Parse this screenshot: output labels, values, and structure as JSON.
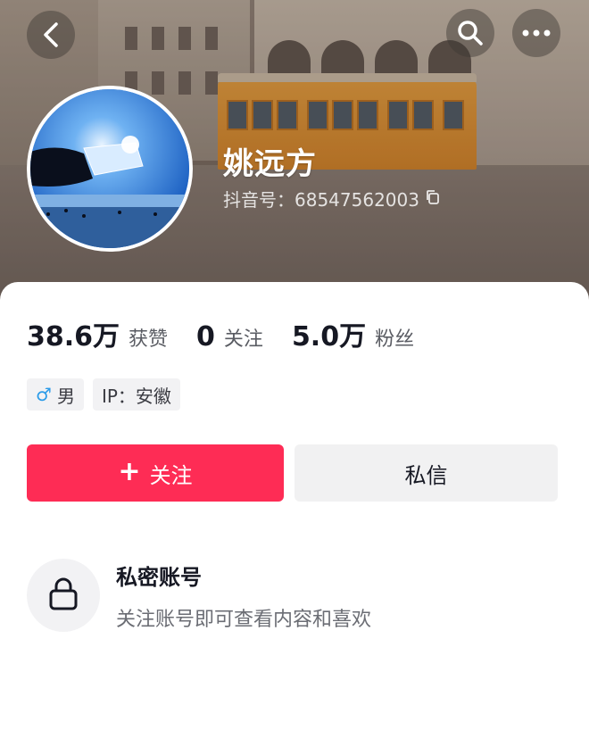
{
  "profile": {
    "name": "姚远方",
    "douyin_id": "抖音号：68547562003"
  },
  "stats": [
    {
      "value": "38.6万",
      "label": "获赞"
    },
    {
      "value": "0",
      "label": "关注"
    },
    {
      "value": "5.0万",
      "label": "粉丝"
    }
  ],
  "tags": {
    "gender_symbol": "♂",
    "gender": "男",
    "ip": "IP：安徽"
  },
  "actions": {
    "follow_plus": "+",
    "follow_label": "关注",
    "message_label": "私信"
  },
  "private_account": {
    "title": "私密账号",
    "subtitle": "关注账号即可查看内容和喜欢"
  },
  "icons": {
    "back": "back-icon",
    "search": "search-icon",
    "more": "more-icon",
    "copy": "copy-icon",
    "lock": "lock-icon"
  },
  "colors": {
    "accent": "#fe2c55",
    "male": "#2b9be8"
  }
}
